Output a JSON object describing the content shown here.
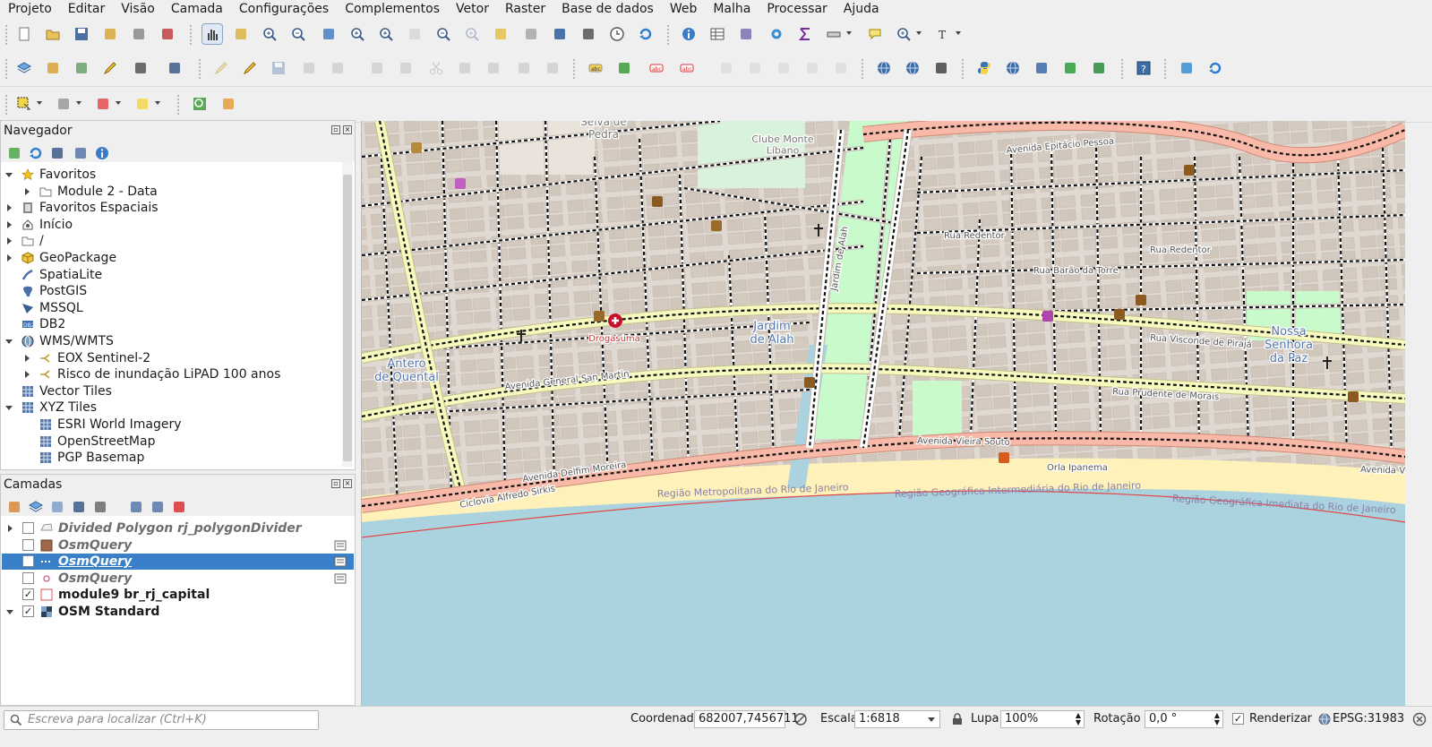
{
  "menubar": [
    "Projeto",
    "Editar",
    "Visão",
    "Camada",
    "Configurações",
    "Complementos",
    "Vetor",
    "Raster",
    "Base de dados",
    "Web",
    "Malha",
    "Processar",
    "Ajuda"
  ],
  "browser": {
    "title": "Navegador",
    "items": [
      {
        "label": "Favoritos",
        "icon": "star-icon",
        "indent": 0,
        "exp": "down"
      },
      {
        "label": "Module 2 - Data",
        "icon": "folder-icon",
        "indent": 1,
        "exp": "right"
      },
      {
        "label": "Favoritos Espaciais",
        "icon": "spatial-bookmarks-icon",
        "indent": 0,
        "exp": "right"
      },
      {
        "label": "Início",
        "icon": "home-icon",
        "indent": 0,
        "exp": "right"
      },
      {
        "label": "/",
        "icon": "folder-icon",
        "indent": 0,
        "exp": "right"
      },
      {
        "label": "GeoPackage",
        "icon": "geopackage-icon",
        "indent": 0,
        "exp": "right"
      },
      {
        "label": "SpatiaLite",
        "icon": "spatialite-icon",
        "indent": 0,
        "exp": ""
      },
      {
        "label": "PostGIS",
        "icon": "postgis-icon",
        "indent": 0,
        "exp": ""
      },
      {
        "label": "MSSQL",
        "icon": "mssql-icon",
        "indent": 0,
        "exp": ""
      },
      {
        "label": "DB2",
        "icon": "db2-icon",
        "indent": 0,
        "exp": ""
      },
      {
        "label": "WMS/WMTS",
        "icon": "globe-icon",
        "indent": 0,
        "exp": "down"
      },
      {
        "label": "EOX Sentinel-2",
        "icon": "wms-layer-icon",
        "indent": 1,
        "exp": "right"
      },
      {
        "label": "Risco de inundação LiPAD 100 anos",
        "icon": "wms-layer-icon",
        "indent": 1,
        "exp": "right"
      },
      {
        "label": "Vector Tiles",
        "icon": "grid-icon",
        "indent": 0,
        "exp": ""
      },
      {
        "label": "XYZ Tiles",
        "icon": "grid-icon",
        "indent": 0,
        "exp": "down"
      },
      {
        "label": "ESRI World Imagery",
        "icon": "grid-icon",
        "indent": 1,
        "exp": ""
      },
      {
        "label": "OpenStreetMap",
        "icon": "grid-icon",
        "indent": 1,
        "exp": ""
      },
      {
        "label": "PGP Basemap",
        "icon": "grid-icon",
        "indent": 1,
        "exp": ""
      }
    ]
  },
  "layers": {
    "title": "Camadas",
    "items": [
      {
        "label": "Divided Polygon rj_polygonDivider",
        "checked": false,
        "style": "italic",
        "symbol": "polygon-outline",
        "exp": "right"
      },
      {
        "label": "OsmQuery",
        "checked": false,
        "style": "italic",
        "symbol": "fill-brown",
        "exp": ""
      },
      {
        "label": "OsmQuery",
        "checked": true,
        "style": "selected",
        "symbol": "line-dash",
        "exp": ""
      },
      {
        "label": "OsmQuery",
        "checked": false,
        "style": "italic",
        "symbol": "point",
        "exp": ""
      },
      {
        "label": "module9 br_rj_capital",
        "checked": true,
        "style": "bold",
        "symbol": "fill-white",
        "exp": ""
      },
      {
        "label": "OSM Standard",
        "checked": true,
        "style": "bold",
        "symbol": "raster",
        "exp": "down"
      }
    ]
  },
  "map_labels": {
    "selva": "Selva de\nPedra",
    "clube": "Clube Monte\nLíbano",
    "jardim_alah": "Jardim\nde Alah",
    "antero": "Antero\nde Quental",
    "nossa": "Nossa\nSenhora\nda Paz",
    "drogaria": "Drogasuma",
    "epitacio": "Avenida Epitácio Pessoa",
    "visconde": "Rua Visconde de Pirajá",
    "general": "Avenida General San Martin",
    "prudente": "Rua Prudente de Morais",
    "vieira": "Avenida Vieira Souto",
    "orla": "Orla Ipanema",
    "ciclovia": "Ciclovia Alfredo Sirkis",
    "delfim": "Avenida Delfim Moreira",
    "regiao1": "Região Metropolitana do Rio de Janeiro",
    "regiao2": "Região Geográfica Intermediária do Rio de Janeiro",
    "regiao3": "Região Geográfica Imediata do Rio de Janeiro",
    "redentor1": "Rua Redentor",
    "redentor2": "Rua Redentor",
    "baraoTorre": "Rua Barão da Torre",
    "canalJardim": "Jardim de Alah",
    "vieira_b": "Avenida Vieira Souto"
  },
  "statusbar": {
    "search_placeholder": "Escreva para localizar (Ctrl+K)",
    "coord_label": "Coordenada",
    "coord_value": "682007,7456711",
    "scale_label": "Escala",
    "scale_value": "1:6818",
    "magnifier_label": "Lupa",
    "magnifier_value": "100%",
    "rotation_label": "Rotação",
    "rotation_value": "0,0 °",
    "render_label": "Renderizar",
    "crs": "EPSG:31983"
  },
  "colors": {
    "selection": "#3a80c9",
    "water": "#aad3df",
    "park": "#c8facc",
    "beach": "#fff1ba",
    "primary": "#f7fabf",
    "trunk": "#f8b9a8"
  }
}
